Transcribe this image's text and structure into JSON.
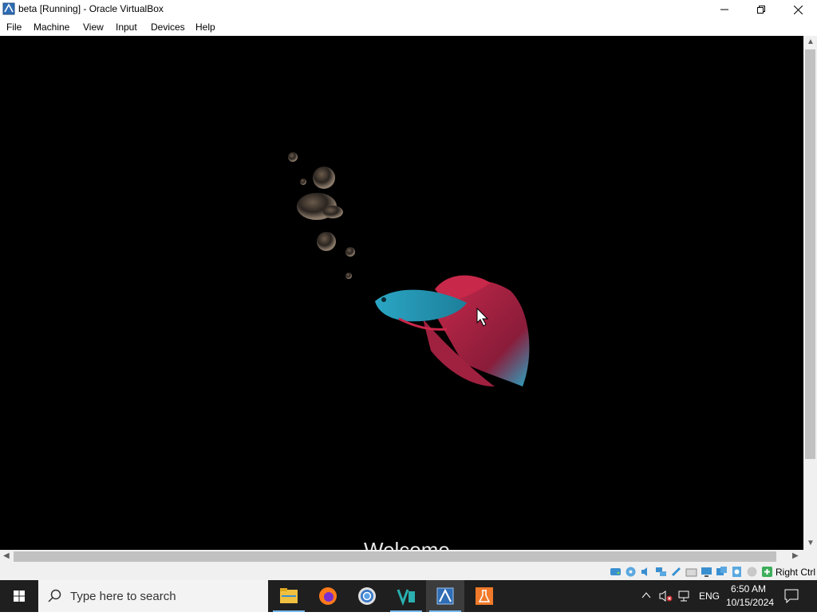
{
  "window": {
    "title": "beta [Running] - Oracle VirtualBox",
    "controls": [
      "minimize",
      "restore",
      "close"
    ]
  },
  "menu": {
    "items": [
      "File",
      "Machine",
      "View",
      "Input",
      "Devices",
      "Help"
    ]
  },
  "vm_screen": {
    "welcome_text": "Welcome"
  },
  "statusbar": {
    "host_key": "Right Ctrl",
    "icons": [
      "hard-disk-icon",
      "optical-disk-icon",
      "audio-icon",
      "network-icon",
      "usb-icon",
      "shared-folders-icon",
      "display-icon",
      "video-capture-icon",
      "recording-icon",
      "cpu-icon",
      "mouse-integration-icon",
      "keyboard-icon"
    ]
  },
  "taskbar": {
    "search_placeholder": "Type here to search",
    "apps": [
      "file-explorer-icon",
      "firefox-icon",
      "chrome-icon",
      "visual-studio-icon",
      "virtualbox-icon",
      "lab-flask-icon"
    ],
    "tray": {
      "language": "ENG",
      "time": "6:50 AM",
      "date": "10/15/2024"
    }
  },
  "colors": {
    "vm_background": "#000000",
    "taskbar": "#1f1f1f",
    "accent": "#76b9ed"
  }
}
